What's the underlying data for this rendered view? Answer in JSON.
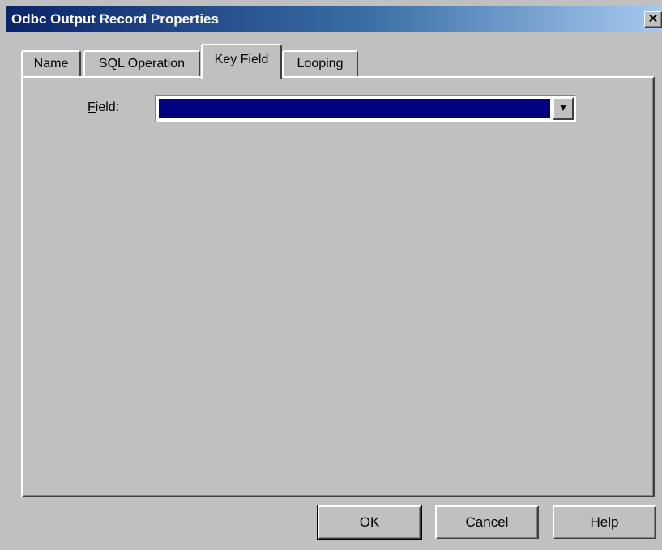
{
  "window": {
    "title": "Odbc Output Record Properties",
    "close_glyph": "✕"
  },
  "tabs": [
    {
      "label": "Name",
      "active": false
    },
    {
      "label": "SQL Operation",
      "active": false
    },
    {
      "label": "Key Field",
      "active": true
    },
    {
      "label": "Looping",
      "active": false
    }
  ],
  "form": {
    "field_label_accel": "F",
    "field_label_rest": "ield:",
    "field_value": "",
    "dropdown_glyph": "▼"
  },
  "buttons": {
    "ok": "OK",
    "cancel": "Cancel",
    "help": "Help"
  },
  "colors": {
    "face": "#c0c0c0",
    "title_start": "#0a246a",
    "selection": "#000080"
  }
}
